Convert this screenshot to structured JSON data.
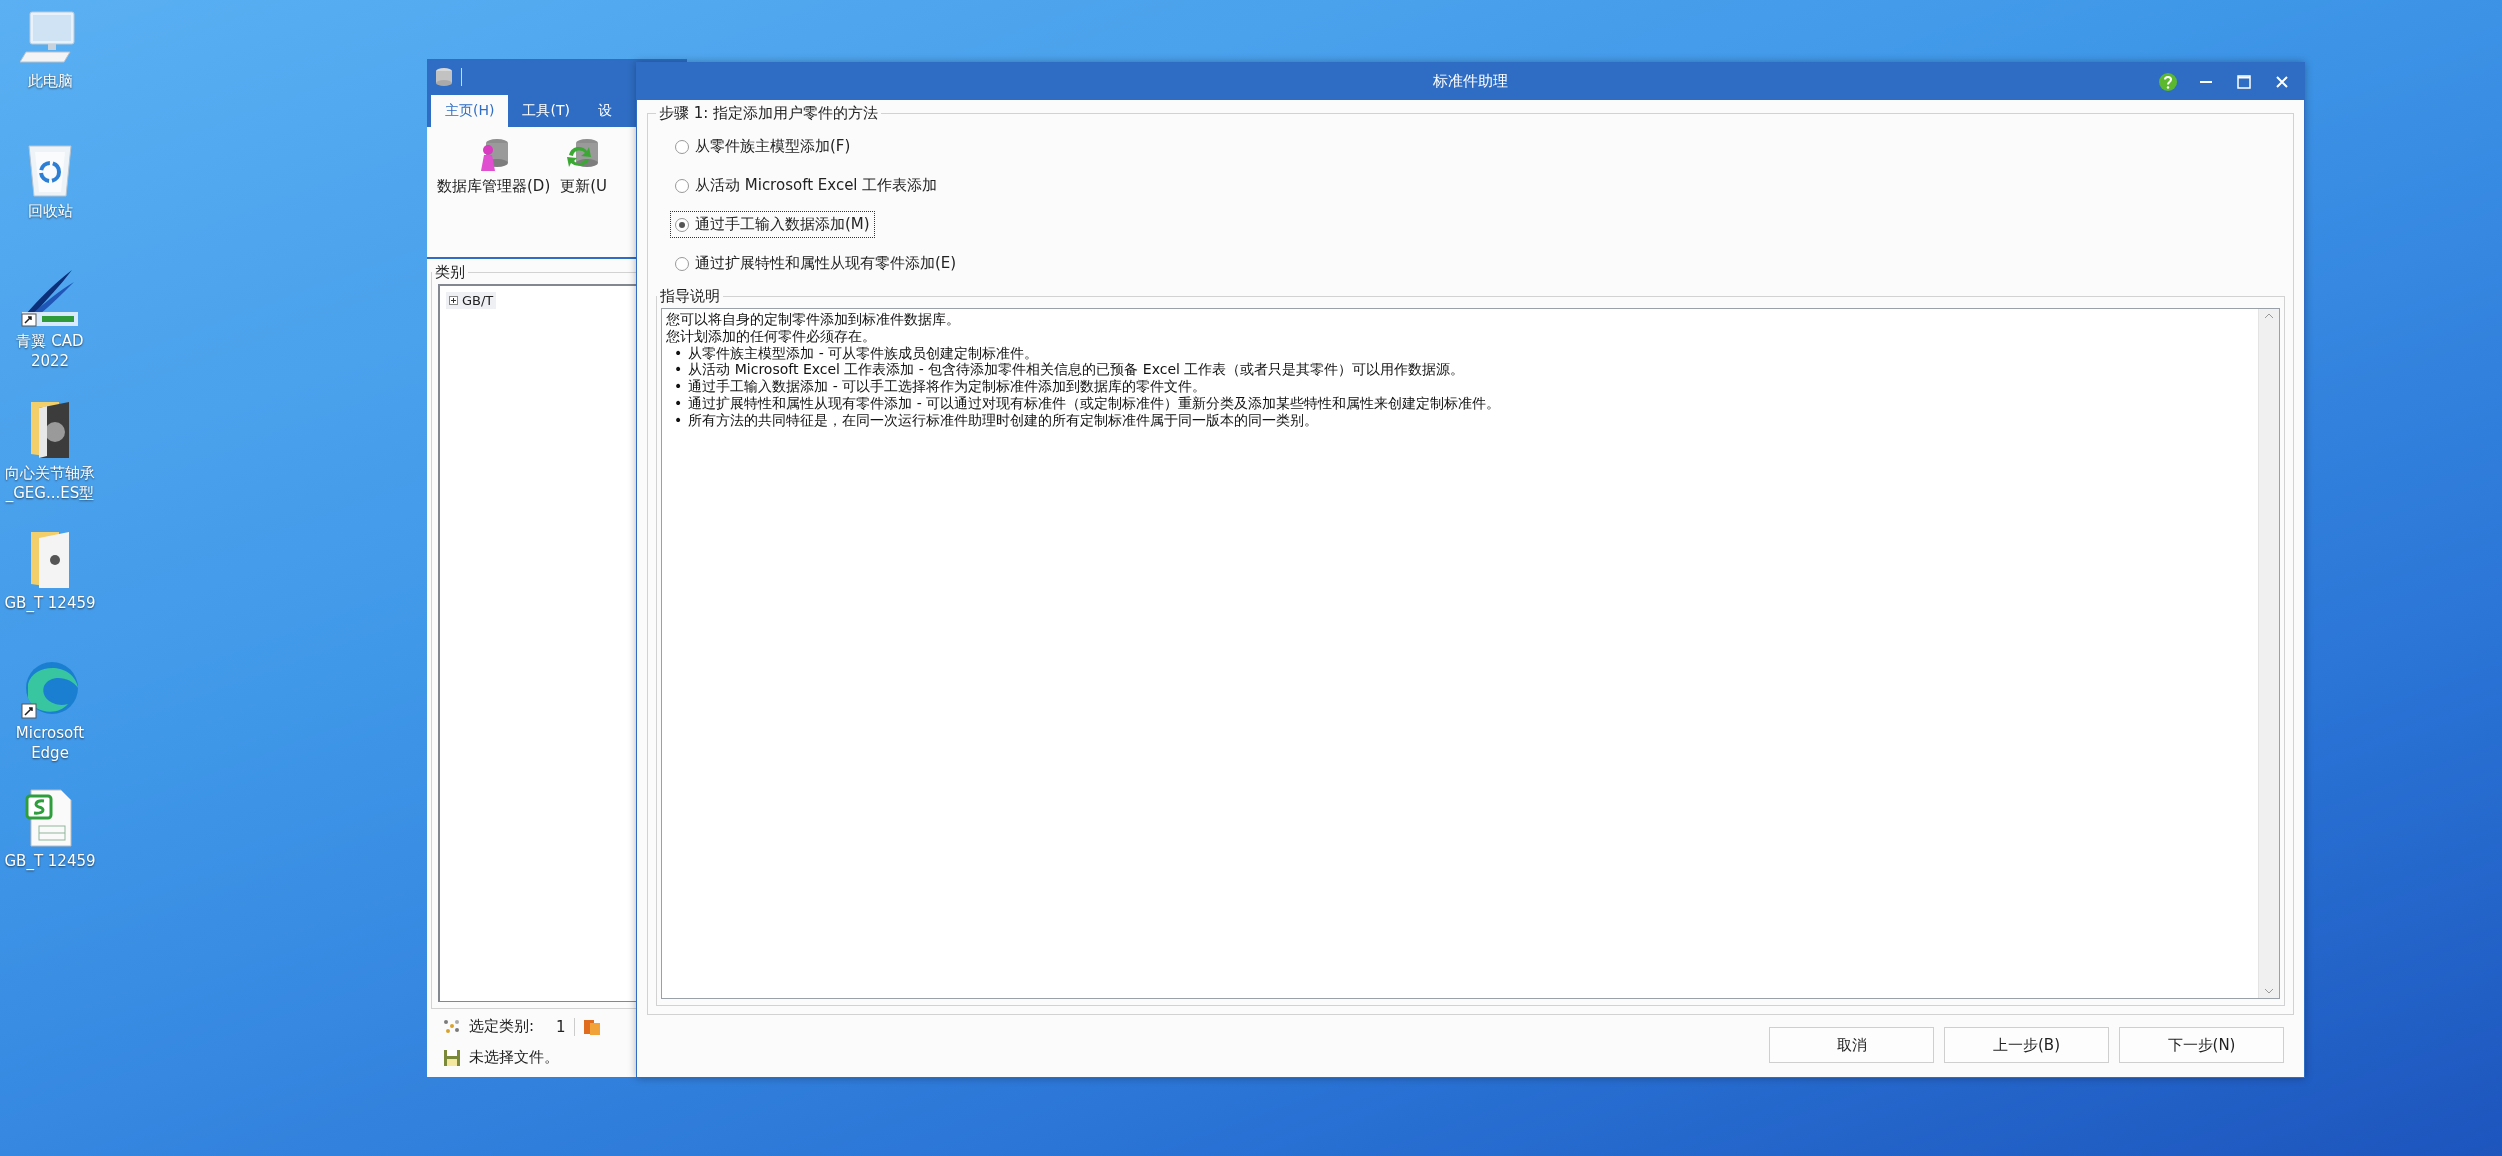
{
  "desktop": {
    "icons": [
      {
        "label": "此电脑",
        "kind": "computer"
      },
      {
        "label": "回收站",
        "kind": "recycle"
      },
      {
        "label": "青翼 CAD 2022",
        "kind": "cad"
      },
      {
        "label": "向心关节轴承_GEG...ES型",
        "kind": "folder-dark"
      },
      {
        "label": "GB_T 12459",
        "kind": "folder"
      },
      {
        "label": "Microsoft Edge",
        "kind": "edge"
      },
      {
        "label": "GB_T 12459",
        "kind": "sheet"
      }
    ]
  },
  "background_window": {
    "tabs": [
      {
        "label": "主页(H)",
        "selected": true
      },
      {
        "label": "工具(T)",
        "selected": false
      },
      {
        "label": "设",
        "selected": false
      }
    ],
    "ribbon_buttons": [
      {
        "label": "数据库管理器(D)",
        "kind": "database-manager"
      },
      {
        "label": "更新(U",
        "kind": "update"
      }
    ],
    "category_group": {
      "title": "类别",
      "tree": [
        {
          "label": "GB/T",
          "expanded": false
        }
      ]
    },
    "status": {
      "selected_label": "选定类别:",
      "selected_count": "1",
      "file_status": "未选择文件。"
    }
  },
  "dialog": {
    "title": "标准件助理",
    "step_group": {
      "title": "步骤 1: 指定添加用户零件的方法",
      "options": [
        {
          "label": "从零件族主模型添加(F)",
          "selected": false
        },
        {
          "label": "从活动 Microsoft Excel 工作表添加",
          "selected": false
        },
        {
          "label": "通过手工输入数据添加(M)",
          "selected": true
        },
        {
          "label": "通过扩展特性和属性从现有零件添加(E)",
          "selected": false
        }
      ]
    },
    "guide": {
      "title": "指导说明",
      "paragraphs": [
        "您可以将自身的定制零件添加到标准件数据库。",
        "您计划添加的任何零件必须存在。"
      ],
      "bullets": [
        {
          "marker": "•",
          "text": "从零件族主模型添加 - 可从零件族成员创建定制标准件。"
        },
        {
          "marker": "•",
          "text": "从活动 Microsoft Excel 工作表添加 - 包含待添加零件相关信息的已预备 Excel 工作表（或者只是其零件）可以用作数据源。"
        },
        {
          "marker": "•",
          "text": "通过手工输入数据添加 - 可以手工选择将作为定制标准件添加到数据库的零件文件。"
        },
        {
          "marker": "•",
          "text": "通过扩展特性和属性从现有零件添加 - 可以通过对现有标准件（或定制标准件）重新分类及添加某些特性和属性来创建定制标准件。"
        },
        {
          "marker": "•",
          "text": "所有方法的共同特征是，在同一次运行标准件助理时创建的所有定制标准件属于同一版本的同一类别。"
        }
      ]
    },
    "buttons": [
      "取消",
      "上一步(B)",
      "下一步(N)"
    ]
  }
}
